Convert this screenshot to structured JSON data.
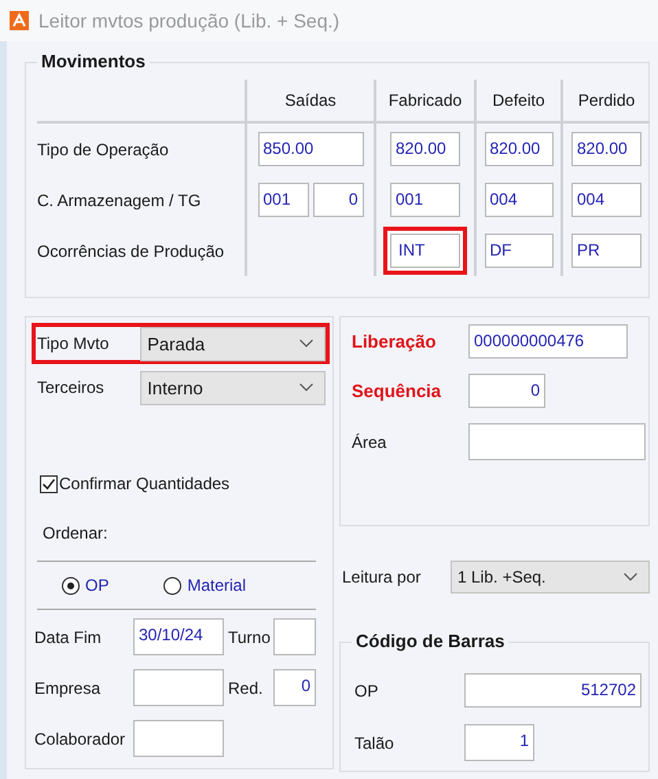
{
  "window": {
    "title": "Leitor mvtos produção (Lib. + Seq.)"
  },
  "movimentos": {
    "title": "Movimentos",
    "columns": [
      "Saídas",
      "Fabricado",
      "Defeito",
      "Perdido"
    ],
    "rows": [
      {
        "label": "Tipo de Operação",
        "cells": [
          [
            {
              "value": "850.00",
              "highlighted": false
            }
          ],
          [
            {
              "value": "820.00",
              "highlighted": false
            }
          ],
          [
            {
              "value": "820.00",
              "highlighted": false
            }
          ],
          [
            {
              "value": "820.00",
              "highlighted": false
            }
          ]
        ]
      },
      {
        "label": "C. Armazenagem / TG",
        "cells": [
          [
            {
              "value": "001",
              "highlighted": false
            },
            {
              "value": "0",
              "highlighted": false
            }
          ],
          [
            {
              "value": "001",
              "highlighted": false
            }
          ],
          [
            {
              "value": "004",
              "highlighted": false
            }
          ],
          [
            {
              "value": "004",
              "highlighted": false
            }
          ]
        ]
      },
      {
        "label": "Ocorrências de Produção",
        "cells": [
          null,
          [
            {
              "value": "INT",
              "highlighted": true
            }
          ],
          [
            {
              "value": "DF",
              "highlighted": false
            }
          ],
          [
            {
              "value": "PR",
              "highlighted": false
            }
          ]
        ]
      }
    ]
  },
  "selects": [
    {
      "label": "Tipo Mvto",
      "value": "Parada",
      "highlighted": true
    },
    {
      "label": "Terceiros",
      "value": "Interno",
      "highlighted": false
    }
  ],
  "confirm": {
    "label": "Confirmar Quantidades",
    "checked": true
  },
  "ordenar": {
    "label": "Ordenar:",
    "options": [
      {
        "label": "OP",
        "selected": true
      },
      {
        "label": "Material",
        "selected": false
      }
    ]
  },
  "left_fields": [
    {
      "label": "Data Fim",
      "value": "30/10/24",
      "label2": "Turno"
    },
    {
      "label": "Empresa",
      "label2": "Red.",
      "value2": "0"
    },
    {
      "label": "Colaborador"
    }
  ],
  "right_fields": [
    {
      "label": "Liberação",
      "value": "000000000476",
      "required": true
    },
    {
      "label": "Sequência",
      "value": "0",
      "required": true
    },
    {
      "label": "Área",
      "required": false
    }
  ],
  "leitura": {
    "label": "Leitura por",
    "value": "1 Lib. +Seq."
  },
  "barcode": {
    "title": "Código de Barras",
    "fields": [
      {
        "label": "OP",
        "value": "512702"
      },
      {
        "label": "Talão",
        "value": "1"
      }
    ]
  }
}
